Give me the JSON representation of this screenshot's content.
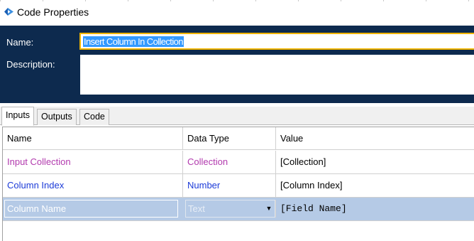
{
  "window": {
    "title": "Code Properties",
    "icon": "blueprism-stage-icon"
  },
  "header": {
    "name_label": "Name:",
    "name_value": "Insert Column In Collection",
    "description_label": "Description:",
    "description_value": ""
  },
  "tabs": [
    {
      "label": "Inputs",
      "active": true
    },
    {
      "label": "Outputs",
      "active": false
    },
    {
      "label": "Code",
      "active": false
    }
  ],
  "grid": {
    "columns": [
      "Name",
      "Data Type",
      "Value"
    ],
    "rows": [
      {
        "name": "Input Collection",
        "type": "Collection",
        "value": "[Collection]",
        "color": "#b23aae"
      },
      {
        "name": "Column Index",
        "type": "Number",
        "value": "[Column Index]",
        "color": "#1c3bd8"
      },
      {
        "name": "Column Name",
        "type": "Text",
        "value": "[Field Name]",
        "editing": true
      }
    ]
  },
  "colors": {
    "header_bg": "#0d2a4e",
    "focus_border": "#f0b400",
    "selection": "#3399ff",
    "row_selected": "#b5cae6"
  }
}
